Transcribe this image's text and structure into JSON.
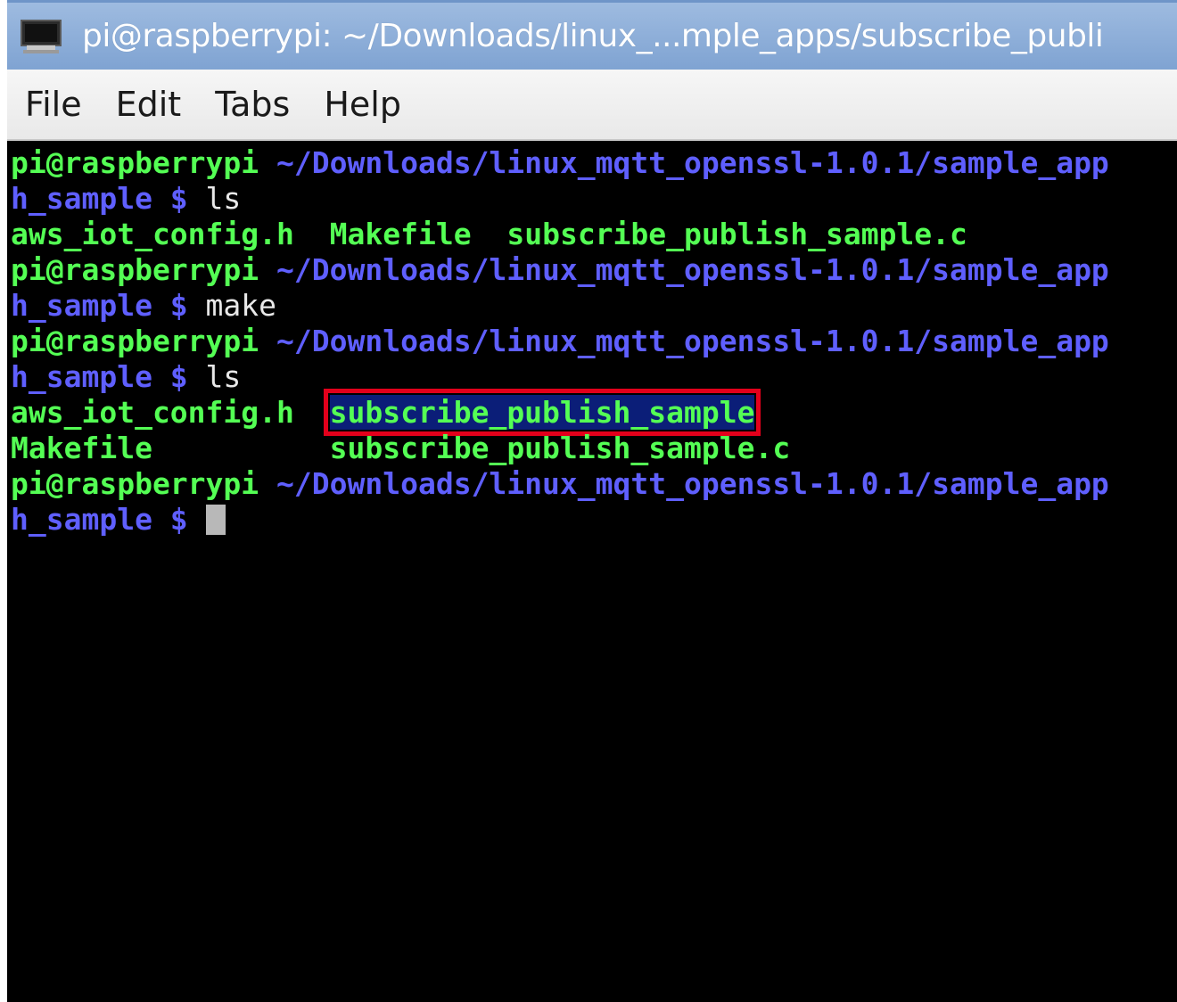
{
  "window": {
    "title": "pi@raspberrypi: ~/Downloads/linux_...mple_apps/subscribe_publi",
    "icon": "terminal-icon"
  },
  "menu": {
    "items": [
      "File",
      "Edit",
      "Tabs",
      "Help"
    ]
  },
  "terminal": {
    "prompt_user": "pi@raspberrypi",
    "prompt_path": " ~/Downloads/linux_mqtt_openssl-1.0.1/sample_app",
    "prompt_cont": "h_sample $ ",
    "cmd_ls": "ls",
    "cmd_make": "make",
    "ls1_file1": "aws_iot_config.h",
    "ls1_file2": "Makefile",
    "ls1_file3": "subscribe_publish_sample.c",
    "ls2_file1": "aws_iot_config.h",
    "ls2_file2": "subscribe_publish_sample",
    "ls2_file3": "Makefile",
    "ls2_file4": "subscribe_publish_sample.c"
  },
  "colors": {
    "prompt_user": "#54ff54",
    "prompt_path": "#5f5fff",
    "highlight_box": "#e3001b",
    "titlebar": "#8eafd9"
  }
}
